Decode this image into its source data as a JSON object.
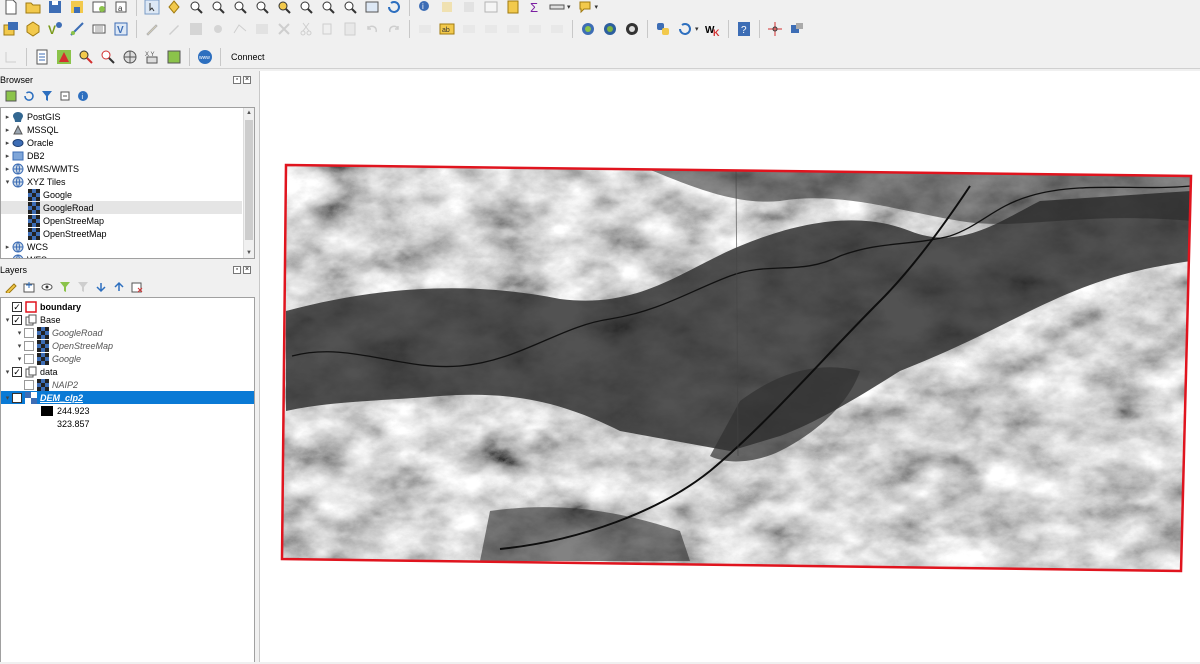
{
  "toolbar": {
    "connect_label": "Connect"
  },
  "browser_panel": {
    "title": "Browser",
    "items": [
      {
        "label": "PostGIS",
        "icon": "postgis-icon",
        "arrow": "▸",
        "indent": 0
      },
      {
        "label": "MSSQL",
        "icon": "mssql-icon",
        "arrow": "▸",
        "indent": 0
      },
      {
        "label": "Oracle",
        "icon": "oracle-icon",
        "arrow": "▸",
        "indent": 0
      },
      {
        "label": "DB2",
        "icon": "db2-icon",
        "arrow": "▸",
        "indent": 0
      },
      {
        "label": "WMS/WMTS",
        "icon": "globe-icon",
        "arrow": "▸",
        "indent": 0
      },
      {
        "label": "XYZ Tiles",
        "icon": "globe-icon",
        "arrow": "▾",
        "indent": 0
      },
      {
        "label": "Google",
        "icon": "xyz-tile-icon",
        "arrow": "",
        "indent": 1
      },
      {
        "label": "GoogleRoad",
        "icon": "xyz-tile-icon",
        "arrow": "",
        "indent": 1
      },
      {
        "label": "OpenStreeMap",
        "icon": "xyz-tile-icon",
        "arrow": "",
        "indent": 1
      },
      {
        "label": "OpenStreetMap",
        "icon": "xyz-tile-icon",
        "arrow": "",
        "indent": 1
      },
      {
        "label": "WCS",
        "icon": "globe-icon",
        "arrow": "▸",
        "indent": 0
      },
      {
        "label": "WFS",
        "icon": "globe-icon",
        "arrow": "▸",
        "indent": 0
      }
    ]
  },
  "layers_panel": {
    "title": "Layers",
    "items": [
      {
        "label": "boundary",
        "type": "boundary",
        "checked": true
      },
      {
        "label": "Base",
        "type": "group",
        "checked": true
      },
      {
        "label": "GoogleRoad",
        "type": "tile",
        "checked": false
      },
      {
        "label": "OpenStreeMap",
        "type": "tile",
        "checked": false
      },
      {
        "label": "Google",
        "type": "tile",
        "checked": false
      },
      {
        "label": "data",
        "type": "group",
        "checked": true
      },
      {
        "label": "NAIP2",
        "type": "tile",
        "checked": false
      },
      {
        "label": "DEM_clp2",
        "type": "raster",
        "checked": true
      }
    ],
    "legend": {
      "max_value": "244.923",
      "min_value": "323.857"
    }
  },
  "colors": {
    "selection": "#0a7ad5",
    "boundary": "#e0141e"
  }
}
